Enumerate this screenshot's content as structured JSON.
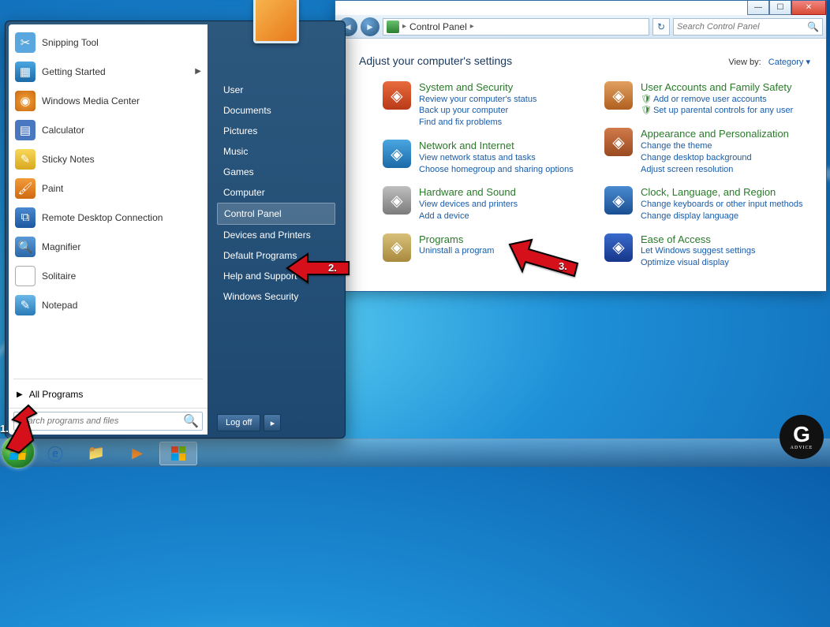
{
  "cp": {
    "breadcrumb": "Control Panel",
    "search_placeholder": "Search Control Panel",
    "title": "Adjust your computer's settings",
    "viewby_label": "View by:",
    "viewby_value": "Category",
    "left_col": [
      {
        "name": "System and Security",
        "links": [
          "Review your computer's status",
          "Back up your computer",
          "Find and fix problems"
        ]
      },
      {
        "name": "Network and Internet",
        "links": [
          "View network status and tasks",
          "Choose homegroup and sharing options"
        ]
      },
      {
        "name": "Hardware and Sound",
        "links": [
          "View devices and printers",
          "Add a device"
        ]
      },
      {
        "name": "Programs",
        "links": [
          "Uninstall a program"
        ]
      }
    ],
    "right_col": [
      {
        "name": "User Accounts and Family Safety",
        "links": [
          "Add or remove user accounts",
          "Set up parental controls for any user"
        ],
        "shield": true
      },
      {
        "name": "Appearance and Personalization",
        "links": [
          "Change the theme",
          "Change desktop background",
          "Adjust screen resolution"
        ]
      },
      {
        "name": "Clock, Language, and Region",
        "links": [
          "Change keyboards or other input methods",
          "Change display language"
        ]
      },
      {
        "name": "Ease of Access",
        "links": [
          "Let Windows suggest settings",
          "Optimize visual display"
        ]
      }
    ]
  },
  "start_menu": {
    "apps": [
      {
        "label": "Snipping Tool",
        "icon": "✂",
        "cls": "a1"
      },
      {
        "label": "Getting Started",
        "icon": "▦",
        "cls": "a2",
        "expand": true
      },
      {
        "label": "Windows Media Center",
        "icon": "◉",
        "cls": "a3"
      },
      {
        "label": "Calculator",
        "icon": "▤",
        "cls": "a4"
      },
      {
        "label": "Sticky Notes",
        "icon": "✎",
        "cls": "a5"
      },
      {
        "label": "Paint",
        "icon": "🖌",
        "cls": "a6"
      },
      {
        "label": "Remote Desktop Connection",
        "icon": "⧉",
        "cls": "a7"
      },
      {
        "label": "Magnifier",
        "icon": "🔍",
        "cls": "a8"
      },
      {
        "label": "Solitaire",
        "icon": "♠",
        "cls": "a9"
      },
      {
        "label": "Notepad",
        "icon": "✎",
        "cls": "a10"
      }
    ],
    "all_programs": "All Programs",
    "search_placeholder": "Search programs and files",
    "right_links": [
      "User",
      "Documents",
      "Pictures",
      "Music",
      "Games",
      "Computer",
      "Control Panel",
      "Devices and Printers",
      "Default Programs",
      "Help and Support",
      "Windows Security"
    ],
    "selected_right": "Control Panel",
    "logoff": "Log off"
  },
  "annotations": {
    "a1": "1.",
    "a2": "2.",
    "a3": "3."
  },
  "gbadge": {
    "g": "G",
    "sub": "ADVICE"
  }
}
